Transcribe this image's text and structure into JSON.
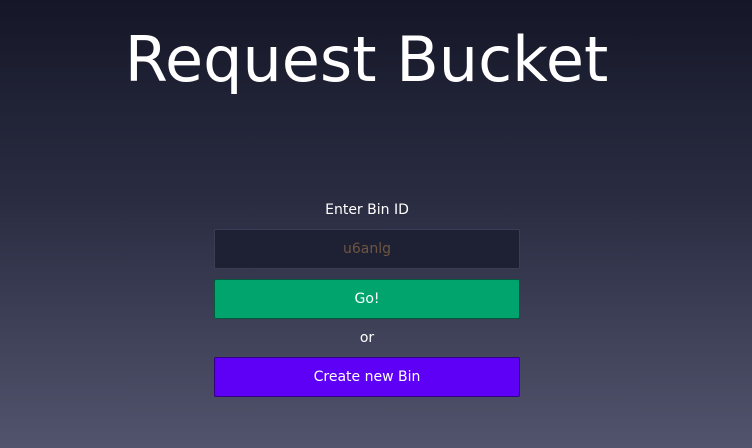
{
  "header": {
    "title": "Request Bucket"
  },
  "form": {
    "label": "Enter Bin ID",
    "input_placeholder": "u6anlg",
    "input_value": "",
    "go_label": "Go!",
    "or_label": "or",
    "create_label": "Create new Bin"
  },
  "colors": {
    "go_button": "#00a46c",
    "create_button": "#5d00f5",
    "input_background": "#1e2033",
    "placeholder_text": "#6e5640"
  }
}
